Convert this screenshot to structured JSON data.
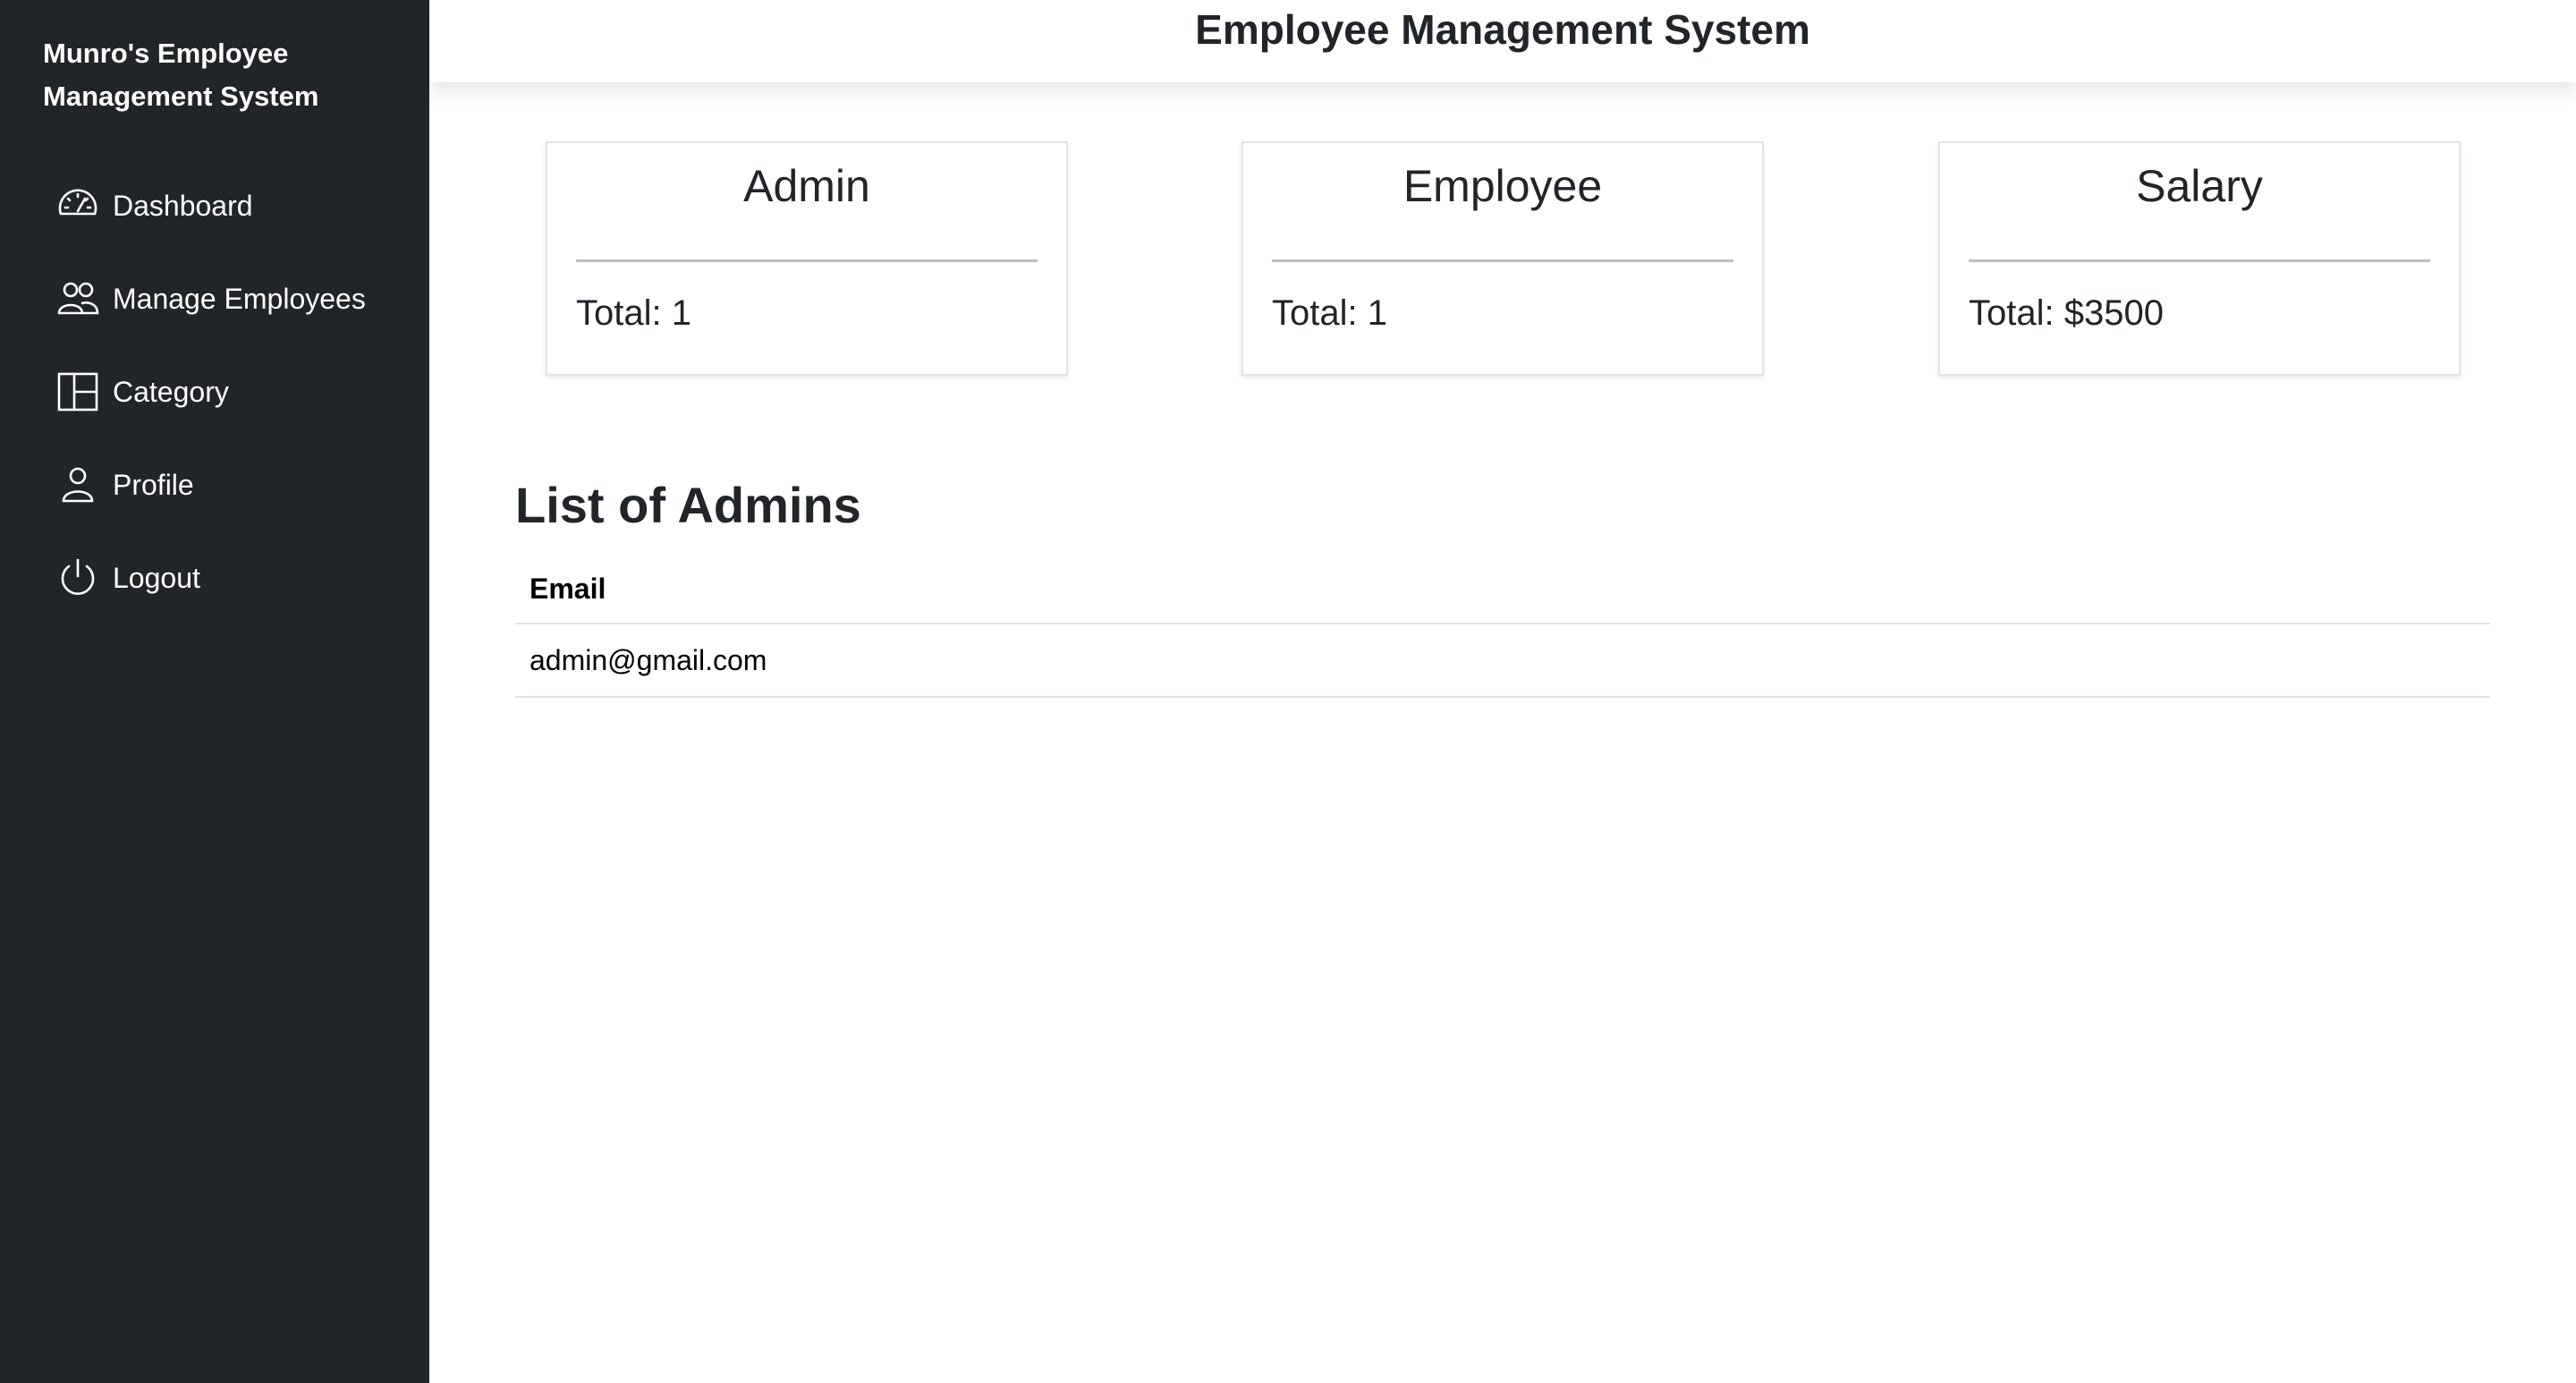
{
  "sidebar": {
    "brand_line1": "Munro's Employee",
    "brand_line2": "Management System",
    "items": [
      {
        "label": "Dashboard",
        "icon": "speedometer-icon"
      },
      {
        "label": "Manage Employees",
        "icon": "people-icon"
      },
      {
        "label": "Category",
        "icon": "columns-icon"
      },
      {
        "label": "Profile",
        "icon": "person-icon"
      },
      {
        "label": "Logout",
        "icon": "power-icon"
      }
    ]
  },
  "header": {
    "title": "Employee Management System"
  },
  "cards": [
    {
      "title": "Admin",
      "total": "Total: 1"
    },
    {
      "title": "Employee",
      "total": "Total: 1"
    },
    {
      "title": "Salary",
      "total": "Total: $3500"
    }
  ],
  "admins": {
    "title": "List of Admins",
    "column_email": "Email",
    "rows": [
      "admin@gmail.com"
    ]
  },
  "colors": {
    "sidebar_bg": "#212529",
    "text": "#212529",
    "border": "#dee2e6"
  }
}
